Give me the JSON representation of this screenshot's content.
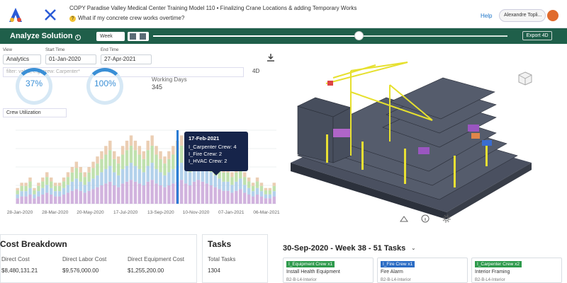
{
  "header": {
    "project_title": "COPY Paradise Valley Medical Center Training Model 110 • Finalizing Crane Locations & adding Temporary Works",
    "scenario": "What if my concrete crew works overtime?",
    "help_label": "Help",
    "user_name": "Alexandre Topli..."
  },
  "toolbar": {
    "title": "Analyze Solution",
    "period": "Week",
    "export_label": "Export 4D",
    "slider_progress": 0.58
  },
  "controls": {
    "view_label": "View",
    "view_value": "Analytics",
    "start_label": "Start Time",
    "start_value": "01-Jan-2020",
    "end_label": "End Time",
    "end_value": "27-Apr-2021",
    "filter_placeholder": "filter: value, e.g. crew: Carpenter*",
    "mode_4d": "4D"
  },
  "kpis": {
    "kpi1": "37%",
    "kpi2": "100%",
    "working_days_label": "Working Days",
    "working_days_value": "345"
  },
  "chart_select": "Crew Utilization",
  "chart_data": {
    "type": "bar",
    "x_ticks": [
      "28-Jan-2020",
      "28-Mar-2020",
      "20-May-2020",
      "17-Jul-2020",
      "13-Sep-2020",
      "10-Nov-2020",
      "07-Jan-2021",
      "06-Mar-2021"
    ],
    "series": [
      {
        "values": [
          3,
          4,
          4,
          5,
          3,
          4,
          5,
          6,
          5,
          4,
          4,
          5,
          6,
          7,
          8,
          7,
          6,
          7,
          8,
          9,
          10,
          11,
          12,
          10,
          9,
          11,
          12,
          13,
          12,
          11,
          10,
          12,
          13,
          11,
          10,
          9,
          10,
          11,
          12,
          13,
          11,
          10,
          12,
          13,
          12,
          11,
          10,
          9,
          8,
          7,
          7,
          6,
          7,
          8,
          6,
          5,
          4,
          5,
          4,
          3,
          3,
          4
        ]
      }
    ],
    "highlight_index": 38,
    "colors": [
      "#c9a6d8",
      "#a6c9e8",
      "#b5dca0",
      "#e8c6a6"
    ]
  },
  "tooltip": {
    "date": "17-Feb-2021",
    "line1": "I_Carpenter Crew: 4",
    "line2": "I_Fire Crew: 2",
    "line3": "I_HVAC Crew: 2"
  },
  "cost": {
    "title": "Cost Breakdown",
    "direct_cost_label": "Direct Cost",
    "direct_cost_value": "$8,480,131.21",
    "labor_label": "Direct Labor Cost",
    "labor_value": "$9,576,000.00",
    "equipment_label": "Direct Equipment Cost",
    "equipment_value": "$1,255,200.00"
  },
  "tasks": {
    "title": "Tasks",
    "total_label": "Total Tasks",
    "total_value": "1304"
  },
  "week_summary": {
    "title": "30-Sep-2020 - Week 38 - 51 Tasks",
    "cards": [
      {
        "tag": "I_Equipment Crew x1",
        "tag_color": "#2e9a4c",
        "name": "Install Health Equipment",
        "loc": "B2-B-L4-Interior"
      },
      {
        "tag": "I_Fire Crew x1",
        "tag_color": "#2b6cc4",
        "name": "Fire Alarm",
        "loc": "B2-B-L4-Interior"
      },
      {
        "tag": "I_Carpenter Crew x2",
        "tag_color": "#2e9a4c",
        "name": "Interior Framing",
        "loc": "B2-B-L4-Interior"
      }
    ]
  }
}
